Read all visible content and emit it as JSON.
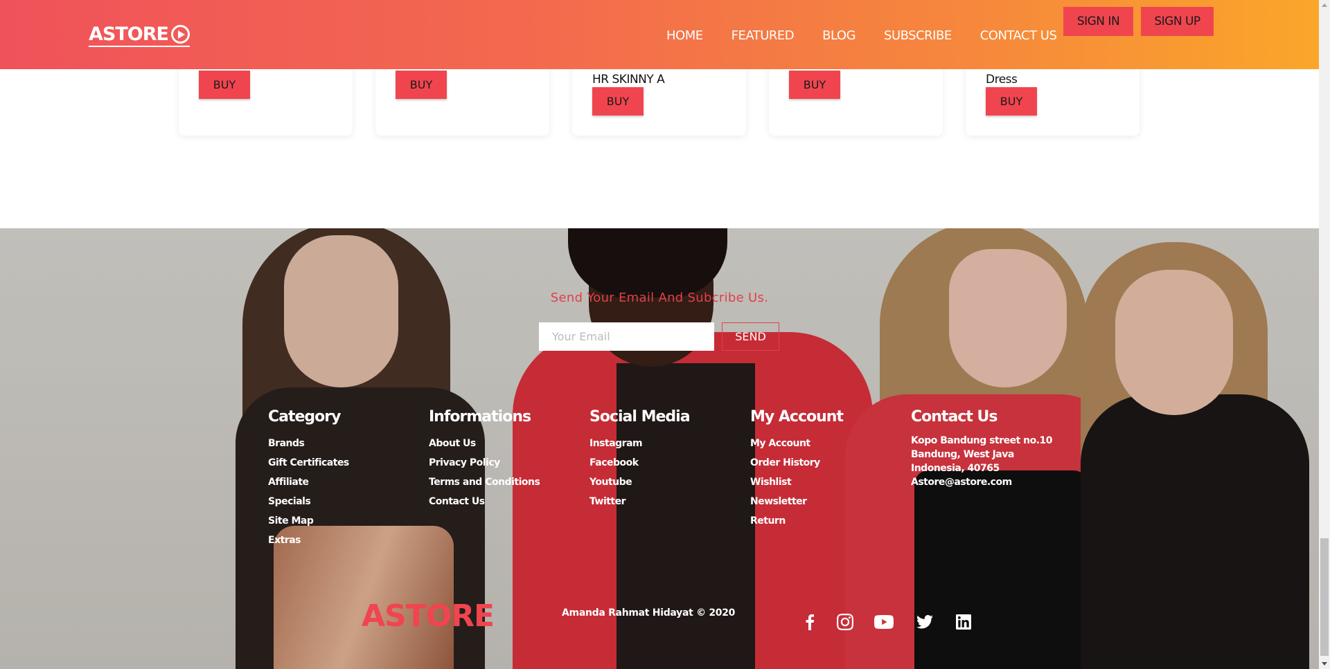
{
  "header": {
    "logo": "ASTORE",
    "nav": [
      "HOME",
      "FEATURED",
      "BLOG",
      "SUBSCRIBE",
      "CONTACT US"
    ],
    "sign_in": "SIGN IN",
    "sign_up": "SIGN UP"
  },
  "products": [
    {
      "name": "",
      "buy": "BUY"
    },
    {
      "name": "",
      "buy": "BUY"
    },
    {
      "name": "HR SKINNY A",
      "buy": "BUY"
    },
    {
      "name": "",
      "buy": "BUY"
    },
    {
      "name": "Dress",
      "buy": "BUY"
    }
  ],
  "subscribe": {
    "title": "Send Your Email And Subcribe Us.",
    "placeholder": "Your Email",
    "send": "SEND"
  },
  "footer": {
    "columns": [
      {
        "title": "Category",
        "items": [
          "Brands",
          "Gift Certificates",
          "Affiliate",
          "Specials",
          "Site Map",
          "Extras"
        ]
      },
      {
        "title": "Informations",
        "items": [
          "About Us",
          "Privacy Policy",
          "Terms and Conditions",
          "Contact Us"
        ]
      },
      {
        "title": "Social Media",
        "items": [
          "Instagram",
          "Facebook",
          "Youtube",
          "Twitter"
        ]
      },
      {
        "title": "My Account",
        "items": [
          "My Account",
          "Order History",
          "Wishlist",
          "Newsletter",
          "Return"
        ]
      }
    ],
    "contact": {
      "title": "Contact Us",
      "lines": [
        "Kopo Bandung street no.10",
        "Bandung, West Java",
        "Indonesia, 40765",
        "Astore@astore.com"
      ]
    },
    "logo": "ASTORE",
    "copyright": "Amanda Rahmat Hidayat © 2020",
    "social_icons": [
      "facebook-icon",
      "instagram-icon",
      "youtube-icon",
      "twitter-icon",
      "linkedin-icon"
    ]
  },
  "colors": {
    "accent": "#f0454f",
    "header_gradient_start": "#f0525a",
    "header_gradient_end": "#fba62a"
  }
}
